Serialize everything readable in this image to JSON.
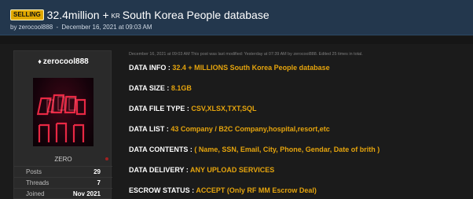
{
  "thread": {
    "prefix": "SELLING",
    "title_part1": "32.4million +",
    "flag_code": "KR",
    "title_part2": "South Korea People database",
    "author": "zerocool888",
    "date": "December 16, 2021 at 09:03 AM"
  },
  "user": {
    "name": "zerocool888",
    "rank": "ZERO",
    "stats": [
      {
        "label": "Posts",
        "value": "29"
      },
      {
        "label": "Threads",
        "value": "7"
      },
      {
        "label": "Joined",
        "value": "Nov 2021"
      }
    ]
  },
  "post": {
    "meta": "December 16, 2021 at 09:03 AM   This post was last modified: Yesterday at 07:39 AM by zerocool888. Edited 25 times in total.",
    "lines": [
      {
        "label": "DATA INFO :",
        "value": "32.4 + MILLIONS South Korea People database"
      },
      {
        "label": "DATA SIZE :",
        "value": "8.1GB"
      },
      {
        "label": "DATA FILE TYPE :",
        "value": "CSV,XLSX,TXT,SQL"
      },
      {
        "label": "DATA LIST :",
        "value": "43 Company / B2C Company,hospital,resort,etc"
      },
      {
        "label": "DATA CONTENTS :",
        "value": "( Name, SSN, Email, City, Phone, Gendar, Date of brith )"
      },
      {
        "label": "DATA DELIVERY :",
        "value": "ANY UPLOAD SERVICES"
      },
      {
        "label": "ESCROW STATUS :",
        "value": "ACCEPT (Only RF MM Escrow Deal)"
      }
    ]
  },
  "colors": {
    "header_bg": "#23374d",
    "prefix_bg": "#e0a800",
    "value_accent": "#e5a40d",
    "page_bg": "#1b1b1b"
  }
}
